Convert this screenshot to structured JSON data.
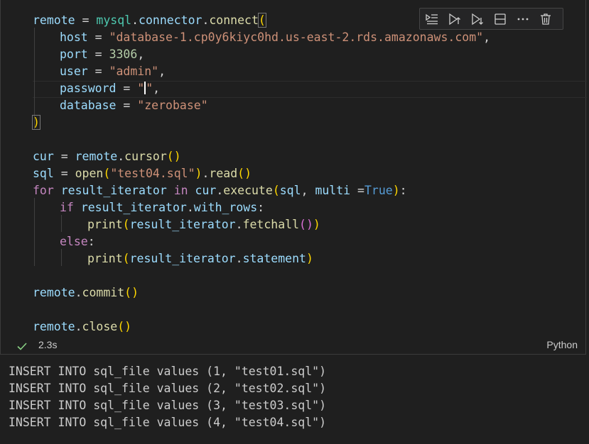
{
  "code": {
    "l1": {
      "a": "remote",
      "b": " = ",
      "c": "mysql",
      "d": ".",
      "e": "connector",
      "f": ".",
      "g": "connect",
      "h": "("
    },
    "l2": {
      "a": "host",
      "b": " = ",
      "c": "\"database-1.cp0y6kiyc0hd.us-east-2.rds.amazonaws.com\"",
      "d": ","
    },
    "l3": {
      "a": "port",
      "b": " = ",
      "c": "3306",
      "d": ","
    },
    "l4": {
      "a": "user",
      "b": " = ",
      "c": "\"admin\"",
      "d": ","
    },
    "l5": {
      "a": "password",
      "b": " = ",
      "c1": "\"",
      "c2": "\"",
      "d": ","
    },
    "l6": {
      "a": "database",
      "b": " = ",
      "c": "\"zerobase\""
    },
    "l7": {
      "a": ")"
    },
    "l8": {
      "a": "cur",
      "b": " = ",
      "c": "remote",
      "d": ".",
      "e": "cursor",
      "f": "()"
    },
    "l9": {
      "a": "sql",
      "b": " = ",
      "c": "open",
      "d": "(",
      "e": "\"test04.sql\"",
      "f": ")",
      "g": ".",
      "h": "read",
      "i": "()"
    },
    "l10": {
      "a": "for",
      "b": " ",
      "c": "result_iterator",
      "d": " ",
      "e": "in",
      "f": " ",
      "g": "cur",
      "h": ".",
      "i": "execute",
      "j": "(",
      "k": "sql",
      "l": ", ",
      "m": "multi",
      "n": " =",
      "o": "True",
      "p": ")",
      ":": ":"
    },
    "l11": {
      "a": "if",
      "b": " ",
      "c": "result_iterator",
      "d": ".",
      "e": "with_rows",
      "f": ":"
    },
    "l12": {
      "a": "print",
      "b": "(",
      "c": "result_iterator",
      "d": ".",
      "e": "fetchall",
      "f": "()",
      "g": ")"
    },
    "l13": {
      "a": "else",
      "b": ":"
    },
    "l14": {
      "a": "print",
      "b": "(",
      "c": "result_iterator",
      "d": ".",
      "e": "statement",
      "f": ")"
    },
    "l15": {
      "a": "remote",
      "b": ".",
      "c": "commit",
      "d": "()"
    },
    "l16": {
      "a": "remote",
      "b": ".",
      "c": "close",
      "d": "()"
    }
  },
  "toolbar": {
    "icons": [
      "execute-above-icon",
      "execute-cell-and-above-icon",
      "execute-cell-and-below-icon",
      "split-cell-icon",
      "more-actions-icon",
      "delete-cell-icon"
    ]
  },
  "status": {
    "time": "2.3s",
    "language": "Python",
    "check_color": "#89d185"
  },
  "output": [
    "INSERT INTO sql_file values (1, \"test01.sql\")",
    "INSERT INTO sql_file values (2, \"test02.sql\")",
    "INSERT INTO sql_file values (3, \"test03.sql\")",
    "INSERT INTO sql_file values (4, \"test04.sql\")"
  ]
}
